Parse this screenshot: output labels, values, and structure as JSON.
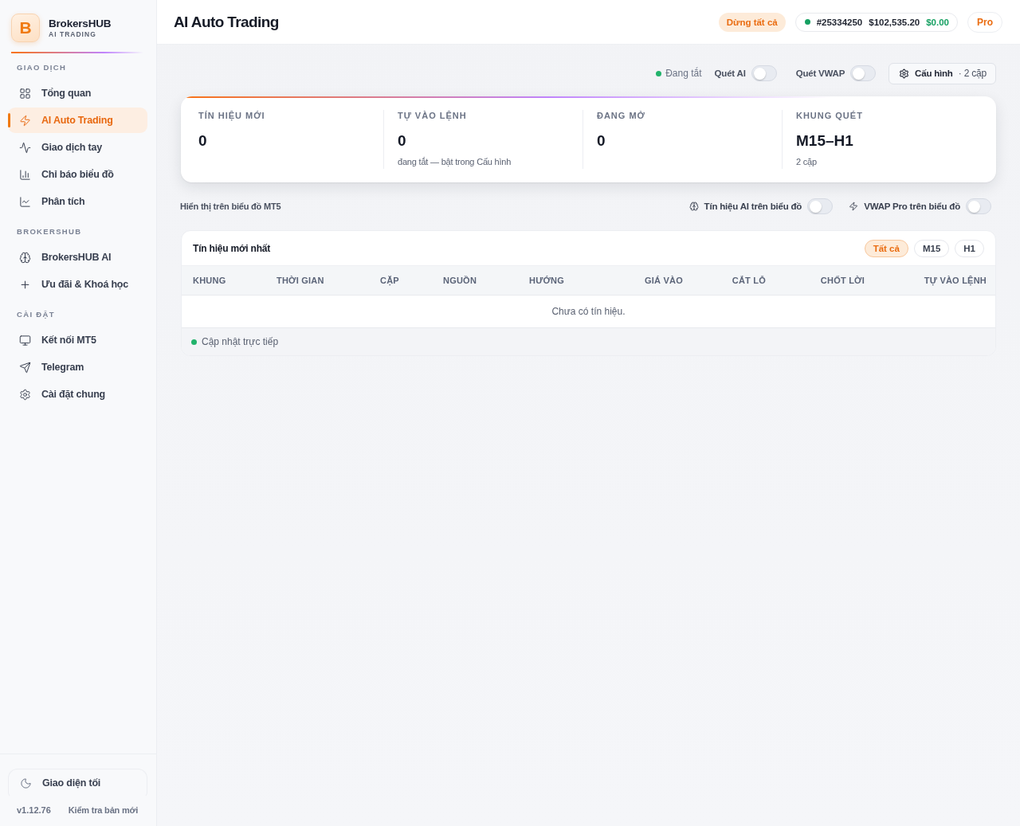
{
  "sidebar": {
    "brand": {
      "logo_letter": "B",
      "name": "BrokersHUB",
      "tagline": "AI TRADING"
    },
    "sections": [
      {
        "title": "GIAO DỊCH",
        "items": [
          {
            "label": "Tổng quan",
            "selected": false
          },
          {
            "label": "AI Auto Trading",
            "selected": true
          },
          {
            "label": "Giao dịch tay",
            "selected": false
          },
          {
            "label": "Chỉ báo biểu đồ",
            "selected": false
          },
          {
            "label": "Phân tích",
            "selected": false
          }
        ]
      },
      {
        "title": "BROKERSHUB",
        "items": [
          {
            "label": "BrokersHUB AI",
            "selected": false
          },
          {
            "label": "Ưu đãi & Khoá học",
            "selected": false
          }
        ]
      },
      {
        "title": "CÀI ĐẶT",
        "items": [
          {
            "label": "Kết nối MT5",
            "selected": false
          },
          {
            "label": "Telegram",
            "selected": false
          },
          {
            "label": "Cài đặt chung",
            "selected": false
          }
        ]
      }
    ],
    "theme_button": "Giao diện tối",
    "version": "v1.12.76",
    "update_link": "Kiểm tra bản mới"
  },
  "header": {
    "title": "AI Auto Trading",
    "stop_all_button": "Dừng tất cả",
    "account": {
      "number": "#25334250",
      "balance": "$102,535.20",
      "profit": "$0.00"
    },
    "plan": "Pro"
  },
  "toolbar": {
    "status": "Đang tắt",
    "toggles": [
      {
        "label": "Quét AI",
        "on": false
      },
      {
        "label": "Quét VWAP",
        "on": false
      }
    ],
    "config_button": {
      "label": "Cấu hình",
      "detail": "· 2 cặp"
    }
  },
  "stats": [
    {
      "label": "TÍN HIỆU MỚI",
      "value": "0"
    },
    {
      "label": "TỰ VÀO LỆNH",
      "value": "0",
      "note": "đang tắt — bật trong Cấu hình"
    },
    {
      "label": "ĐANG MỞ",
      "value": "0"
    },
    {
      "label": "KHUNG QUÉT",
      "value": "M15–H1",
      "note": "2 cặp"
    }
  ],
  "chart_display": {
    "title": "Hiển thị trên biểu đồ MT5",
    "toggles": [
      {
        "label": "Tín hiệu AI trên biểu đồ",
        "on": false
      },
      {
        "label": "VWAP Pro trên biểu đồ",
        "on": false
      }
    ]
  },
  "signals": {
    "title": "Tín hiệu mới nhất",
    "filters": [
      {
        "label": "Tất cả",
        "selected": true
      },
      {
        "label": "M15",
        "selected": false
      },
      {
        "label": "H1",
        "selected": false
      }
    ],
    "columns": [
      "KHUNG",
      "THỜI GIAN",
      "CẶP",
      "NGUỒN",
      "HƯỚNG",
      "GIÁ VÀO",
      "CẮT LỖ",
      "CHỐT LỜI",
      "TỰ VÀO LỆNH"
    ],
    "empty_message": "Chưa có tín hiệu.",
    "footer": "Cập nhật trực tiếp"
  }
}
